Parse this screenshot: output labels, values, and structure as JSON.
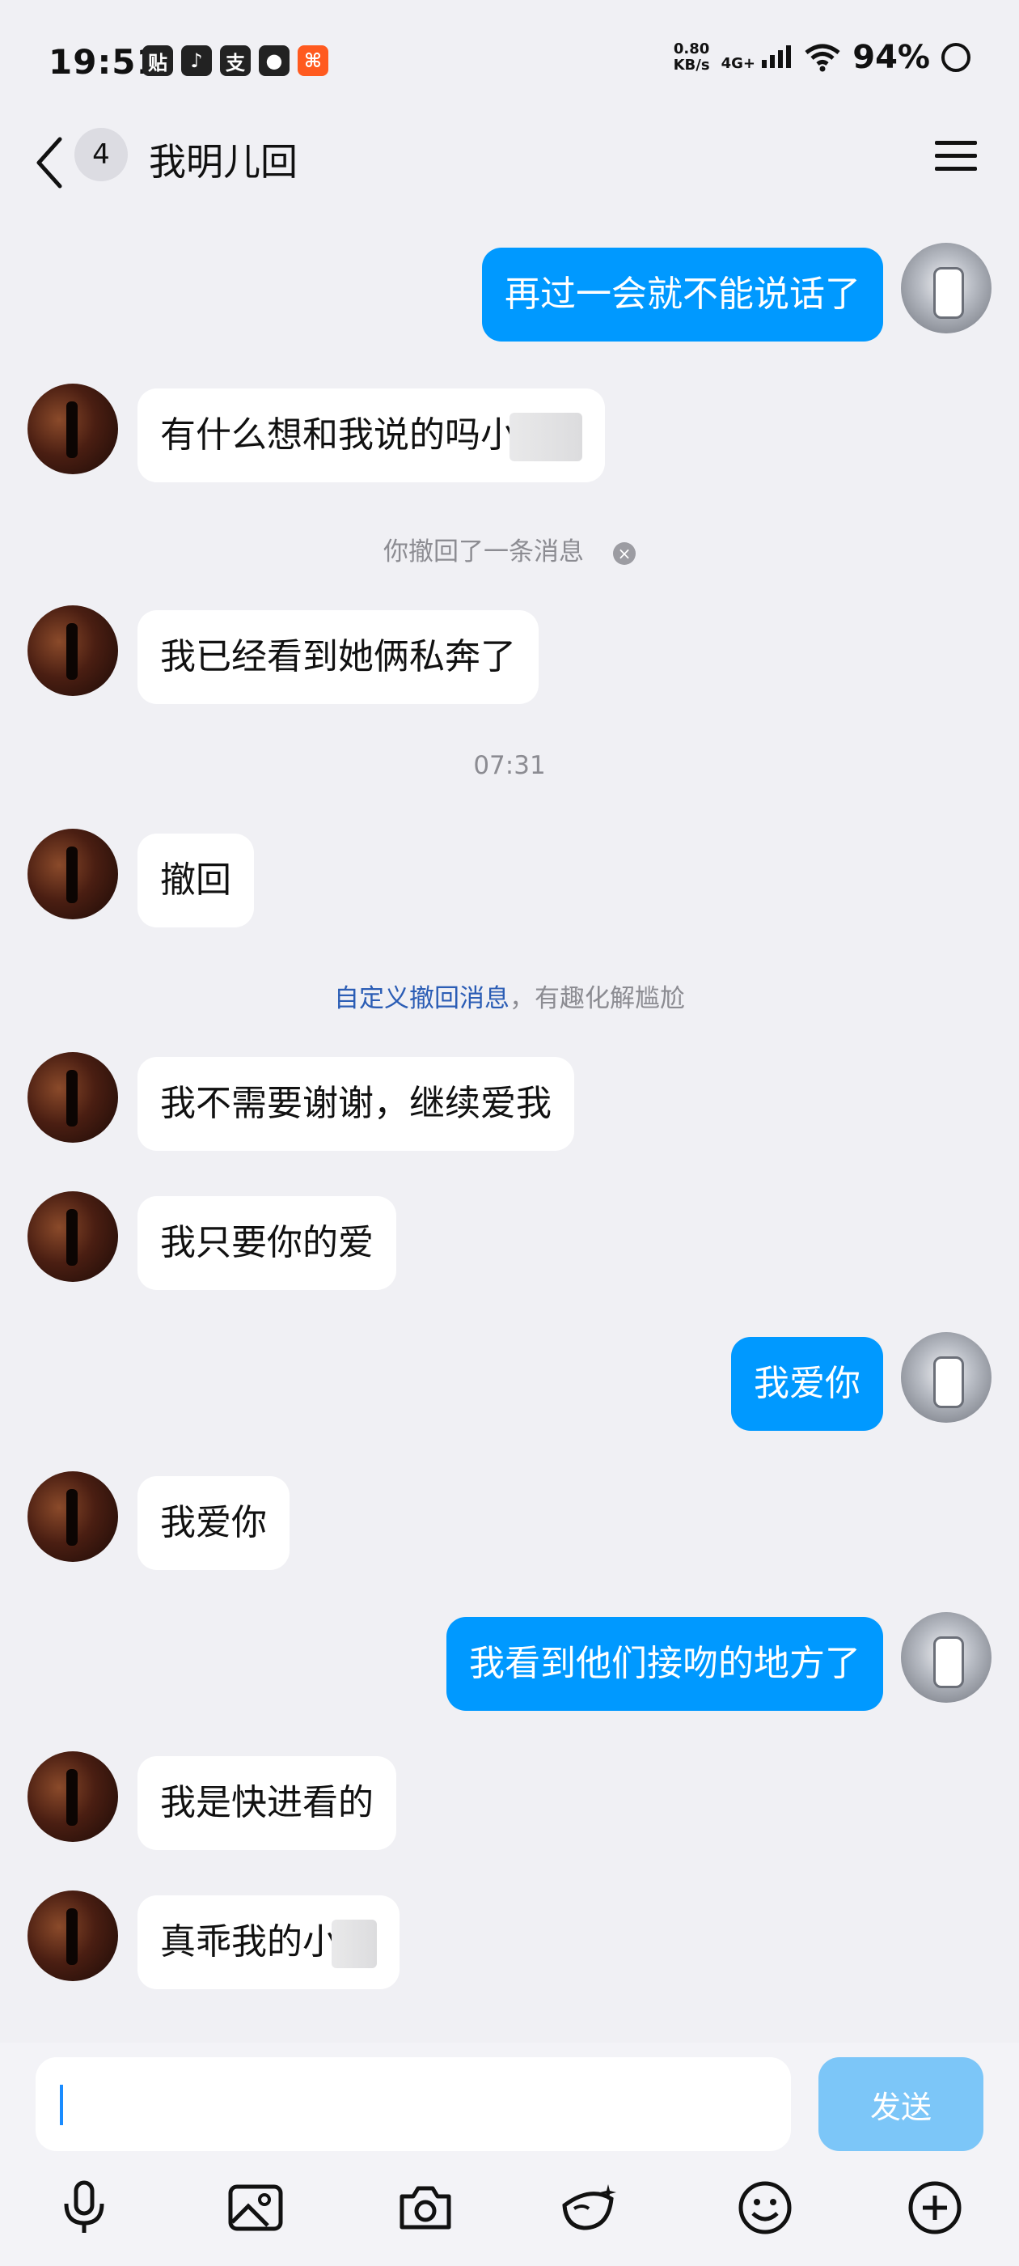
{
  "status_bar": {
    "time": "19:51",
    "net_speed_value": "0.80",
    "net_speed_unit": "KB/s",
    "signal": "4G+",
    "battery": "94%"
  },
  "header": {
    "unread_count": "4",
    "title": "我明儿回"
  },
  "messages": [
    {
      "side": "right",
      "text": "再过一会就不能说话了"
    },
    {
      "side": "left",
      "text": "有什么想和我说的吗小"
    },
    {
      "side": "system",
      "text": "你撤回了一条消息"
    },
    {
      "side": "left",
      "text": "我已经看到她俩私奔了"
    },
    {
      "side": "system",
      "text": "07:31"
    },
    {
      "side": "left",
      "text": "撤回"
    },
    {
      "side": "system",
      "link": "自定义撤回消息",
      "text": "，有趣化解尴尬"
    },
    {
      "side": "left",
      "text": "我不需要谢谢，继续爱我"
    },
    {
      "side": "left",
      "text": "我只要你的爱"
    },
    {
      "side": "right",
      "text": "我爱你"
    },
    {
      "side": "left",
      "text": "我爱你"
    },
    {
      "side": "right",
      "text": "我看到他们接吻的地方了"
    },
    {
      "side": "left",
      "text": "我是快进看的"
    },
    {
      "side": "left",
      "text": "真乖我的小"
    }
  ],
  "input": {
    "value": "",
    "send_label": "发送"
  },
  "toolbar_icons": [
    "microphone-icon",
    "image-icon",
    "camera-icon",
    "mask-icon",
    "emoji-icon",
    "plus-icon"
  ],
  "colors": {
    "outgoing_bubble": "#0099ff",
    "incoming_bubble": "#ffffff",
    "send_button": "#7cc6f8",
    "recall_link": "#2b5db5"
  }
}
